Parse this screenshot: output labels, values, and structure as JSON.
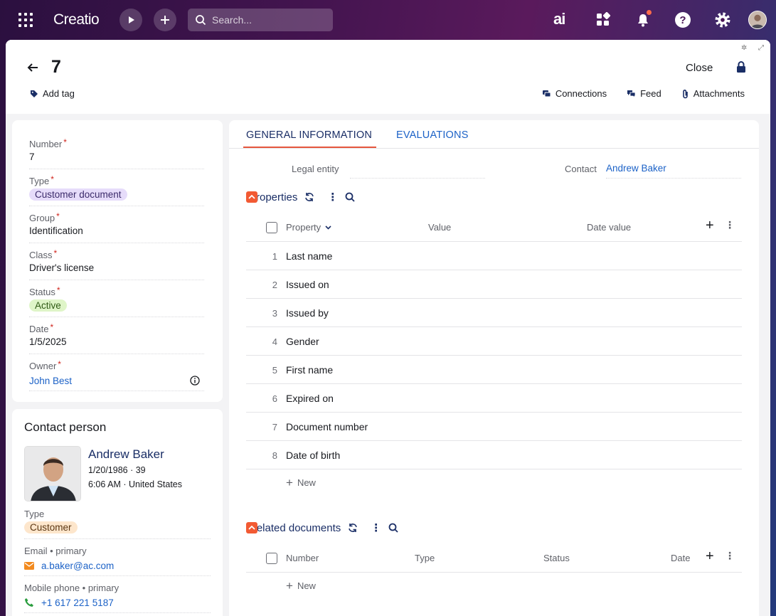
{
  "topbar": {
    "logo": "Creatio",
    "search_placeholder": "Search...",
    "ai_label": "ai"
  },
  "header": {
    "record_title": "7",
    "close_label": "Close",
    "add_tag_label": "Add tag",
    "links": [
      "Connections",
      "Feed",
      "Attachments"
    ]
  },
  "fields": [
    {
      "label": "Number",
      "value": "7",
      "style": "text"
    },
    {
      "label": "Type",
      "value": "Customer document",
      "style": "chip-purple"
    },
    {
      "label": "Group",
      "value": "Identification",
      "style": "text"
    },
    {
      "label": "Class",
      "value": "Driver's license",
      "style": "text"
    },
    {
      "label": "Status",
      "value": "Active",
      "style": "chip-green"
    },
    {
      "label": "Date",
      "value": "1/5/2025",
      "style": "text"
    },
    {
      "label": "Owner",
      "value": "John Best",
      "style": "link"
    }
  ],
  "contact_card": {
    "title": "Contact person",
    "name": "Andrew Baker",
    "birth": "1/20/1986 · 39",
    "local": "6:06 AM · United States",
    "type_label": "Type",
    "type_value": "Customer",
    "email_label": "Email • primary",
    "email": "a.baker@ac.com",
    "phone_label": "Mobile phone • primary",
    "phone": "+1 617 221 5187"
  },
  "tabs": [
    "GENERAL INFORMATION",
    "EVALUATIONS"
  ],
  "general": {
    "legal_entity_label": "Legal entity",
    "legal_entity_value": "",
    "contact_label": "Contact",
    "contact_value": "Andrew Baker"
  },
  "properties": {
    "title": "Properties",
    "columns": [
      "Property",
      "Value",
      "Date value"
    ],
    "rows": [
      {
        "n": "1",
        "name": "Last name"
      },
      {
        "n": "2",
        "name": "Issued on"
      },
      {
        "n": "3",
        "name": "Issued by"
      },
      {
        "n": "4",
        "name": "Gender"
      },
      {
        "n": "5",
        "name": "First name"
      },
      {
        "n": "6",
        "name": "Expired on"
      },
      {
        "n": "7",
        "name": "Document number"
      },
      {
        "n": "8",
        "name": "Date of birth"
      }
    ],
    "new_label": "New"
  },
  "related": {
    "title": "Related documents",
    "columns": [
      "Number",
      "Type",
      "Status",
      "Date"
    ],
    "new_label": "New"
  },
  "colors": {
    "accent": "#f25a33",
    "link": "#1c62c7",
    "navy": "#1a2e66"
  }
}
